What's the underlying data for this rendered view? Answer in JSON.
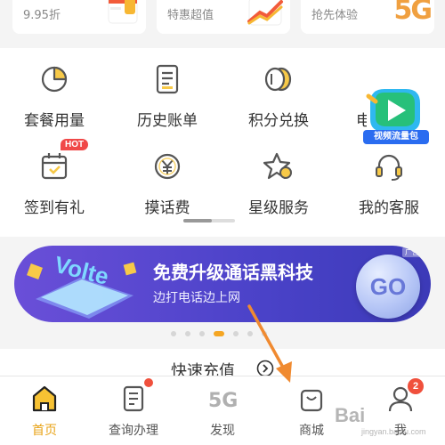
{
  "promos": [
    {
      "text": "9.95折",
      "icon": "calendar-card-icon"
    },
    {
      "text": "特惠超值",
      "icon": "trend-up-icon"
    },
    {
      "text": "抢先体验",
      "icon": "5g-logo-icon",
      "logo_text": "5G"
    }
  ],
  "services": [
    {
      "label": "套餐用量",
      "icon": "pie-chart-icon"
    },
    {
      "label": "历史账单",
      "icon": "bill-icon"
    },
    {
      "label": "积分兑换",
      "icon": "coins-icon"
    },
    {
      "label": "电",
      "icon": "yuan-card-icon"
    },
    {
      "label": "签到有礼",
      "icon": "calendar-check-icon",
      "badge": "HOT"
    },
    {
      "label": "摸话费",
      "icon": "yuan-circle-icon"
    },
    {
      "label": "星级服务",
      "icon": "star-service-icon"
    },
    {
      "label": "我的客服",
      "icon": "headset-icon"
    }
  ],
  "float_widget": {
    "label": "视频流量包",
    "icon": "video-play-icon"
  },
  "banner": {
    "ad_tag": "广告",
    "title": "免费升级通话黑科技",
    "subtitle": "边打电话边上网",
    "go_label": "GO",
    "art_text": "Volte"
  },
  "carousel": {
    "count": 7,
    "active_index": 3
  },
  "quick_recharge": {
    "label": "快速充值"
  },
  "nav": [
    {
      "label": "首页",
      "icon": "home-icon",
      "active": true
    },
    {
      "label": "查询办理",
      "icon": "document-icon",
      "dot": true
    },
    {
      "label": "发现",
      "icon": "5g-discover-icon",
      "logo_text": "5G"
    },
    {
      "label": "商城",
      "icon": "shopping-bag-icon"
    },
    {
      "label": "我",
      "icon": "user-icon",
      "badge": "2"
    }
  ],
  "watermark": {
    "text": "Bai",
    "sub": "jingyan.baidu.com"
  },
  "colors": {
    "accent": "#e8a317",
    "banner": "#4a42c8",
    "badge": "#f0503c",
    "arrow": "#f08a30"
  }
}
